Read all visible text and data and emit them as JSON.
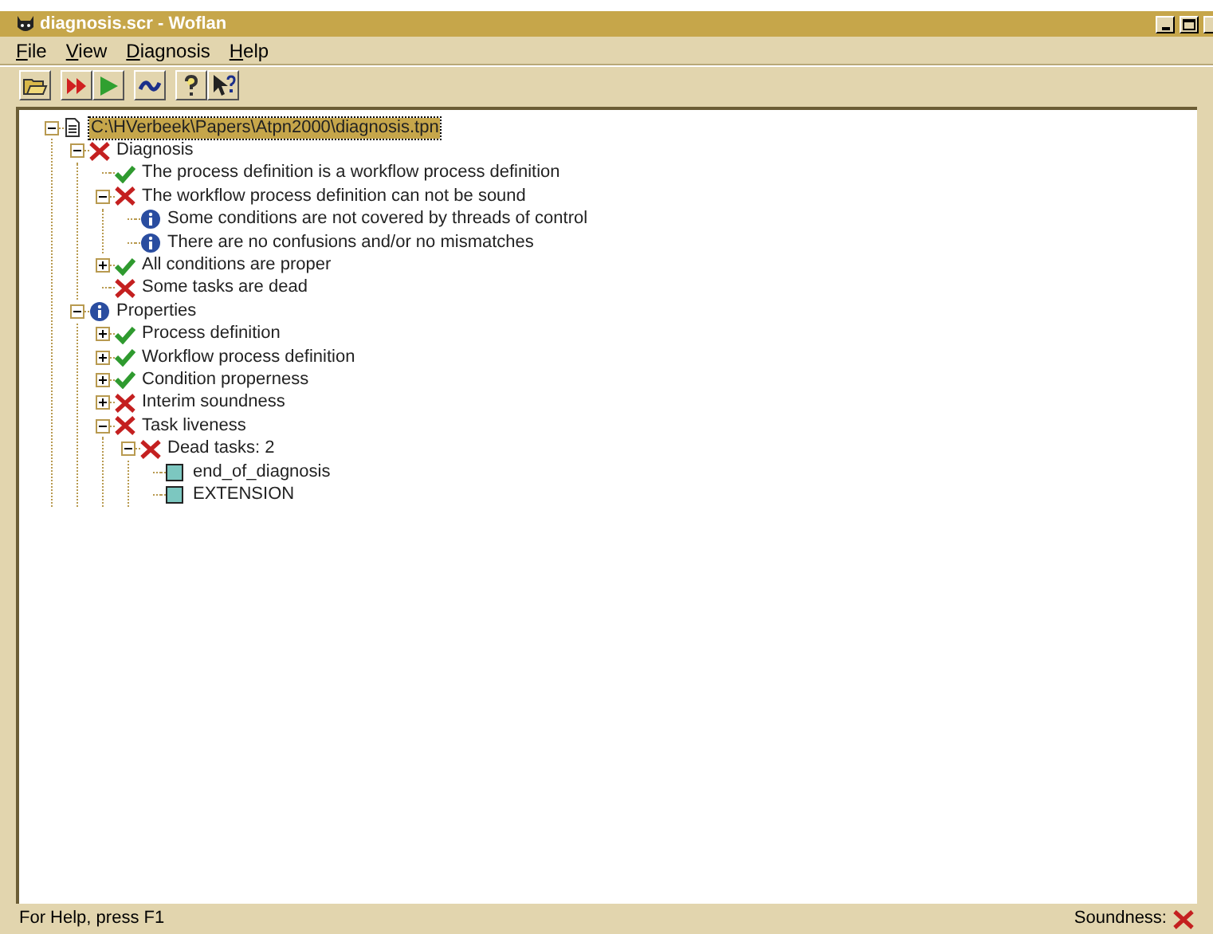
{
  "window": {
    "title": "diagnosis.scr - Woflan"
  },
  "menu": [
    {
      "label": "File"
    },
    {
      "label": "View"
    },
    {
      "label": "Diagnosis"
    },
    {
      "label": "Help"
    }
  ],
  "toolbar": [
    {
      "kind": "open"
    },
    {
      "kind": "fast-forward"
    },
    {
      "kind": "play"
    },
    {
      "kind": "wave"
    },
    {
      "kind": "help"
    },
    {
      "kind": "context-help"
    }
  ],
  "tree": [
    {
      "label": "C:\\HVerbeek\\Papers\\Atpn2000\\diagnosis.tpn",
      "kind": "document",
      "expanded": true,
      "selected": true,
      "children": [
        {
          "label": "Diagnosis",
          "kind": "cross",
          "expanded": true,
          "selected": false,
          "children": [
            {
              "label": "The process definition is a workflow process definition",
              "kind": "check",
              "selected": false
            },
            {
              "label": "The workflow process definition can not be sound",
              "kind": "cross",
              "expanded": true,
              "selected": false,
              "children": [
                {
                  "label": "Some conditions are not covered by threads of control",
                  "kind": "info",
                  "selected": false
                },
                {
                  "label": "There are no confusions and/or no mismatches",
                  "kind": "info",
                  "selected": false
                }
              ]
            },
            {
              "label": "All conditions are proper",
              "kind": "check",
              "expanded": false,
              "selected": false
            },
            {
              "label": "Some tasks are dead",
              "kind": "cross",
              "selected": false
            }
          ]
        },
        {
          "label": "Properties",
          "kind": "info",
          "expanded": true,
          "selected": false,
          "children": [
            {
              "label": "Process definition",
              "kind": "check",
              "expanded": false,
              "selected": false
            },
            {
              "label": "Workflow process definition",
              "kind": "check",
              "expanded": false,
              "selected": false
            },
            {
              "label": "Condition properness",
              "kind": "check",
              "expanded": false,
              "selected": false
            },
            {
              "label": "Interim soundness",
              "kind": "cross",
              "expanded": false,
              "selected": false
            },
            {
              "label": "Task liveness",
              "kind": "cross",
              "expanded": true,
              "selected": false,
              "children": [
                {
                  "label": "Dead tasks: 2",
                  "kind": "cross",
                  "expanded": true,
                  "selected": false,
                  "children": [
                    {
                      "label": "end_of_diagnosis",
                      "kind": "task",
                      "selected": false
                    },
                    {
                      "label": "EXTENSION",
                      "kind": "task",
                      "selected": false
                    }
                  ]
                }
              ]
            }
          ]
        }
      ]
    }
  ],
  "status_bar": {
    "help": "For Help, press F1",
    "soundness": {
      "label": "Soundness:",
      "kind": "cross"
    }
  }
}
